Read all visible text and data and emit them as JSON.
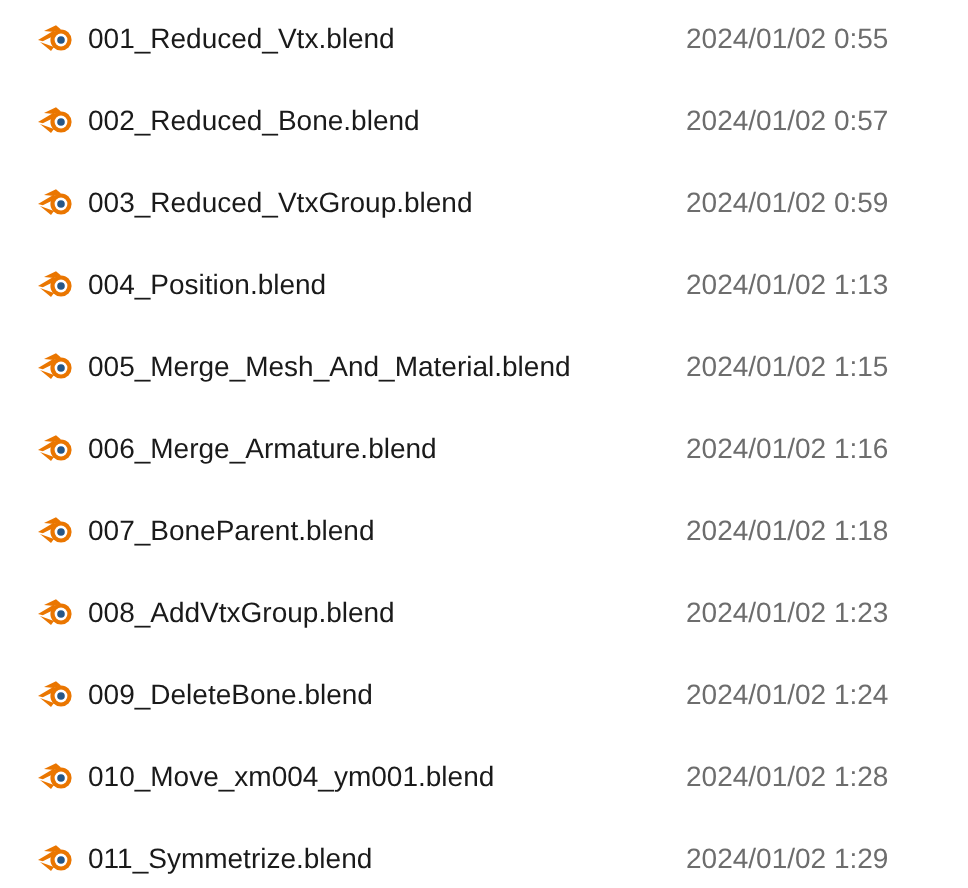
{
  "files": [
    {
      "name": "001_Reduced_Vtx.blend",
      "modified": "2024/01/02 0:55"
    },
    {
      "name": "002_Reduced_Bone.blend",
      "modified": "2024/01/02 0:57"
    },
    {
      "name": "003_Reduced_VtxGroup.blend",
      "modified": "2024/01/02 0:59"
    },
    {
      "name": "004_Position.blend",
      "modified": "2024/01/02 1:13"
    },
    {
      "name": "005_Merge_Mesh_And_Material.blend",
      "modified": "2024/01/02 1:15"
    },
    {
      "name": "006_Merge_Armature.blend",
      "modified": "2024/01/02 1:16"
    },
    {
      "name": "007_BoneParent.blend",
      "modified": "2024/01/02 1:18"
    },
    {
      "name": "008_AddVtxGroup.blend",
      "modified": "2024/01/02 1:23"
    },
    {
      "name": "009_DeleteBone.blend",
      "modified": "2024/01/02 1:24"
    },
    {
      "name": "010_Move_xm004_ym001.blend",
      "modified": "2024/01/02 1:28"
    },
    {
      "name": "011_Symmetrize.blend",
      "modified": "2024/01/02 1:29"
    }
  ]
}
